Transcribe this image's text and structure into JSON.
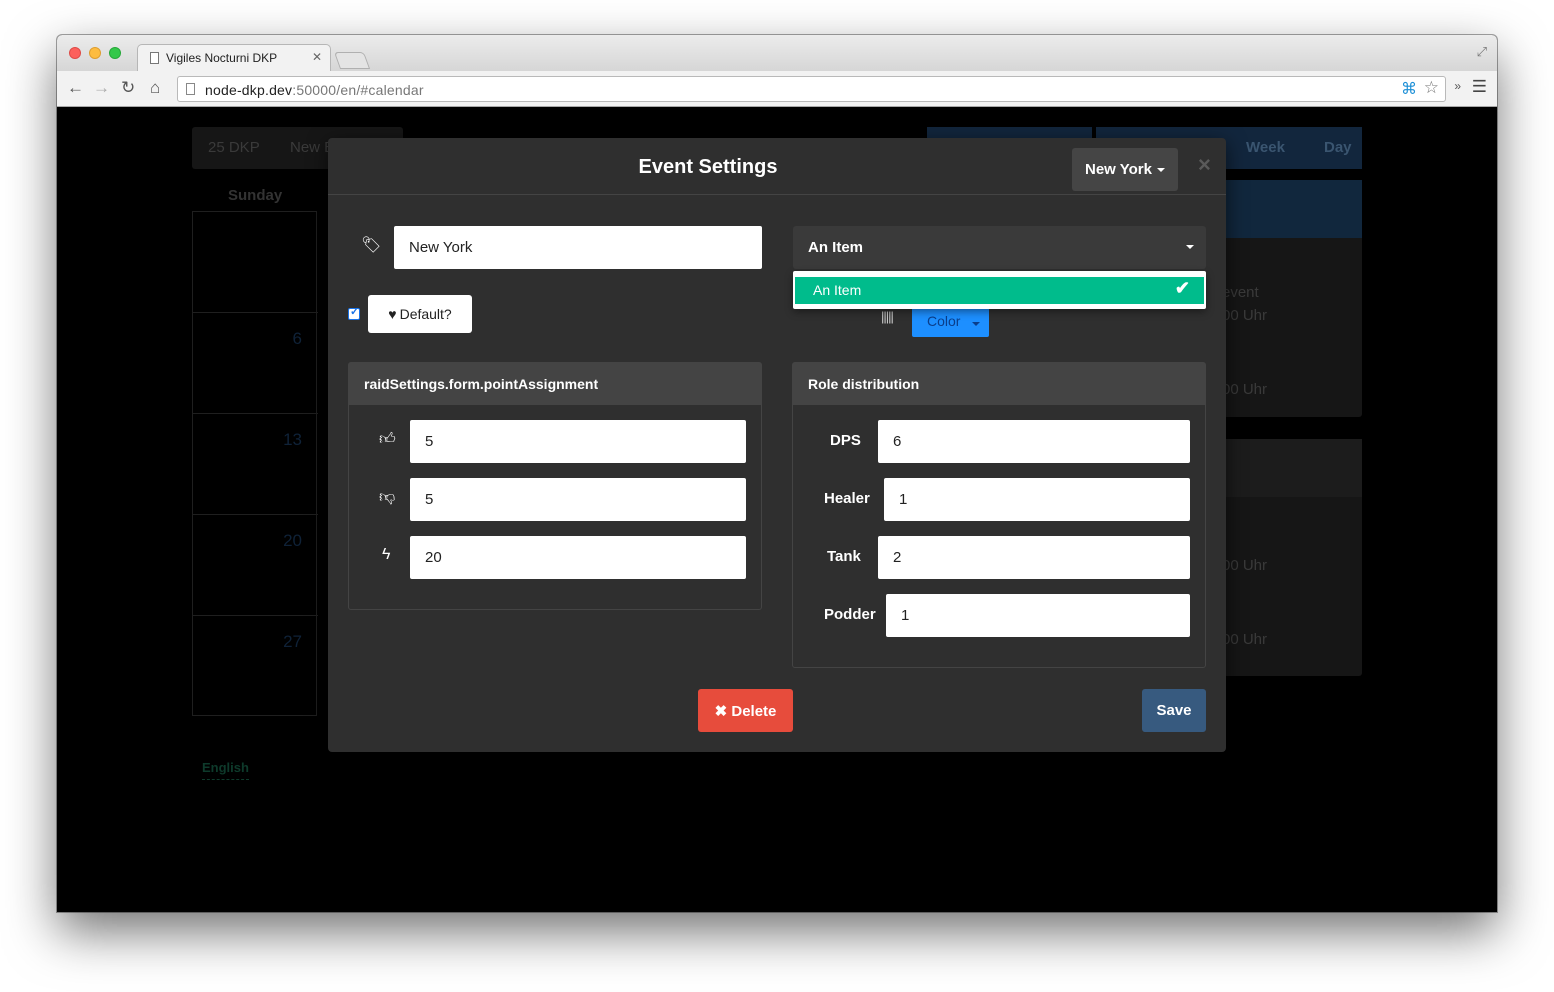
{
  "browser": {
    "tab_title": "Vigiles Nocturni DKP",
    "url_host": "node-dkp.dev",
    "url_rest": ":50000/en/#calendar"
  },
  "background": {
    "dkp_label": "25 DKP",
    "new_label": "New E",
    "sunday": "Sunday",
    "day_numbers": [
      "",
      "6",
      "13",
      "20",
      "27"
    ],
    "view_buttons": [
      "",
      "",
      "Week",
      "Day"
    ],
    "event_texts": [
      "event",
      "00 Uhr",
      "00 Uhr",
      "00 Uhr",
      "00 Uhr"
    ],
    "language": "English"
  },
  "modal": {
    "title": "Event Settings",
    "location_button": "New York",
    "name_value": "New York",
    "select_value": "An Item",
    "dropdown_items": [
      {
        "label": "An Item",
        "selected": true
      }
    ],
    "default_label": "Default?",
    "default_checked": true,
    "color_label": "Color",
    "point_panel": {
      "title": "raidSettings.form.pointAssignment",
      "up_value": "5",
      "down_value": "5",
      "bolt_value": "20"
    },
    "role_panel": {
      "title": "Role distribution",
      "roles": [
        {
          "label": "DPS",
          "value": "6"
        },
        {
          "label": "Healer",
          "value": "1"
        },
        {
          "label": "Tank",
          "value": "2"
        },
        {
          "label": "Podder",
          "value": "1"
        }
      ]
    },
    "delete_label": "Delete",
    "save_label": "Save"
  },
  "colors": {
    "accent_green": "#00bc8c",
    "danger": "#e74c3c",
    "primary": "#375a7f",
    "color_button": "#1d8fff"
  },
  "icons": {
    "tag": "tag-icon",
    "heart": "heart-icon",
    "thumbs_up": "thumbs-up-icon",
    "thumbs_down": "thumbs-down-icon",
    "bolt": "bolt-icon",
    "barcode": "barcode-icon",
    "check": "check-icon",
    "remove": "remove-icon"
  }
}
